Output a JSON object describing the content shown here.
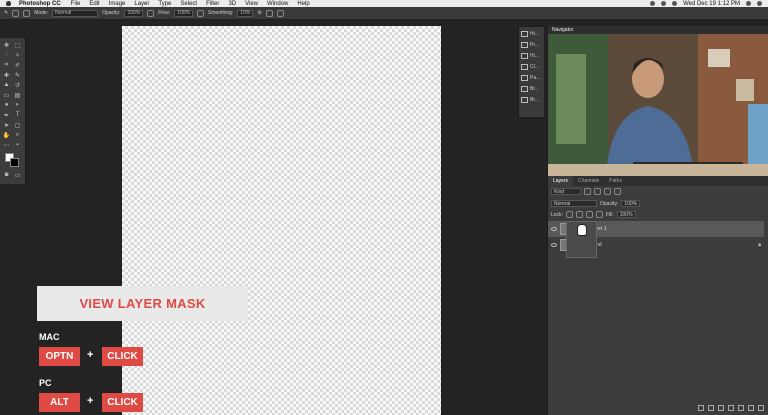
{
  "menubar": {
    "app_name": "Photoshop CC",
    "items": [
      "File",
      "Edit",
      "Image",
      "Layer",
      "Type",
      "Select",
      "Filter",
      "3D",
      "View",
      "Window",
      "Help"
    ],
    "clock": "Wed Dec 19  1:12 PM"
  },
  "options_bar": {
    "mode_label": "Mode:",
    "mode_value": "Normal",
    "opacity_label": "Opacity:",
    "opacity_value": "100%",
    "flow_label": "Flow:",
    "flow_value": "100%",
    "smoothing_label": "Smoothing:",
    "smoothing_value": "10%"
  },
  "dock": {
    "items": [
      "Hi...",
      "Pr...",
      "Hi...",
      "Cl...",
      "Pa...",
      "Br...",
      "Br..."
    ]
  },
  "navigator": {
    "title": "Navigator"
  },
  "layers_panel": {
    "tabs": [
      "Layers",
      "Channels",
      "Paths"
    ],
    "kind_label": "Kind",
    "blend_mode": "Normal",
    "opacity_label": "Opacity:",
    "opacity_value": "100%",
    "lock_label": "Lock:",
    "fill_label": "Fill:",
    "fill_value": "100%",
    "layers": [
      {
        "name": "Layer 1",
        "selected": true
      },
      {
        "name": "Background",
        "selected": false
      }
    ]
  },
  "overlay": {
    "banner": "VIEW LAYER MASK",
    "mac_label": "MAC",
    "mac_key1": "OPTN",
    "mac_key2": "CLICK",
    "pc_label": "PC",
    "pc_key1": "ALT",
    "pc_key2": "CLICK",
    "plus": "+"
  },
  "colors": {
    "accent": "#e04a45",
    "panel": "#3c3c3c",
    "background": "#232323"
  }
}
